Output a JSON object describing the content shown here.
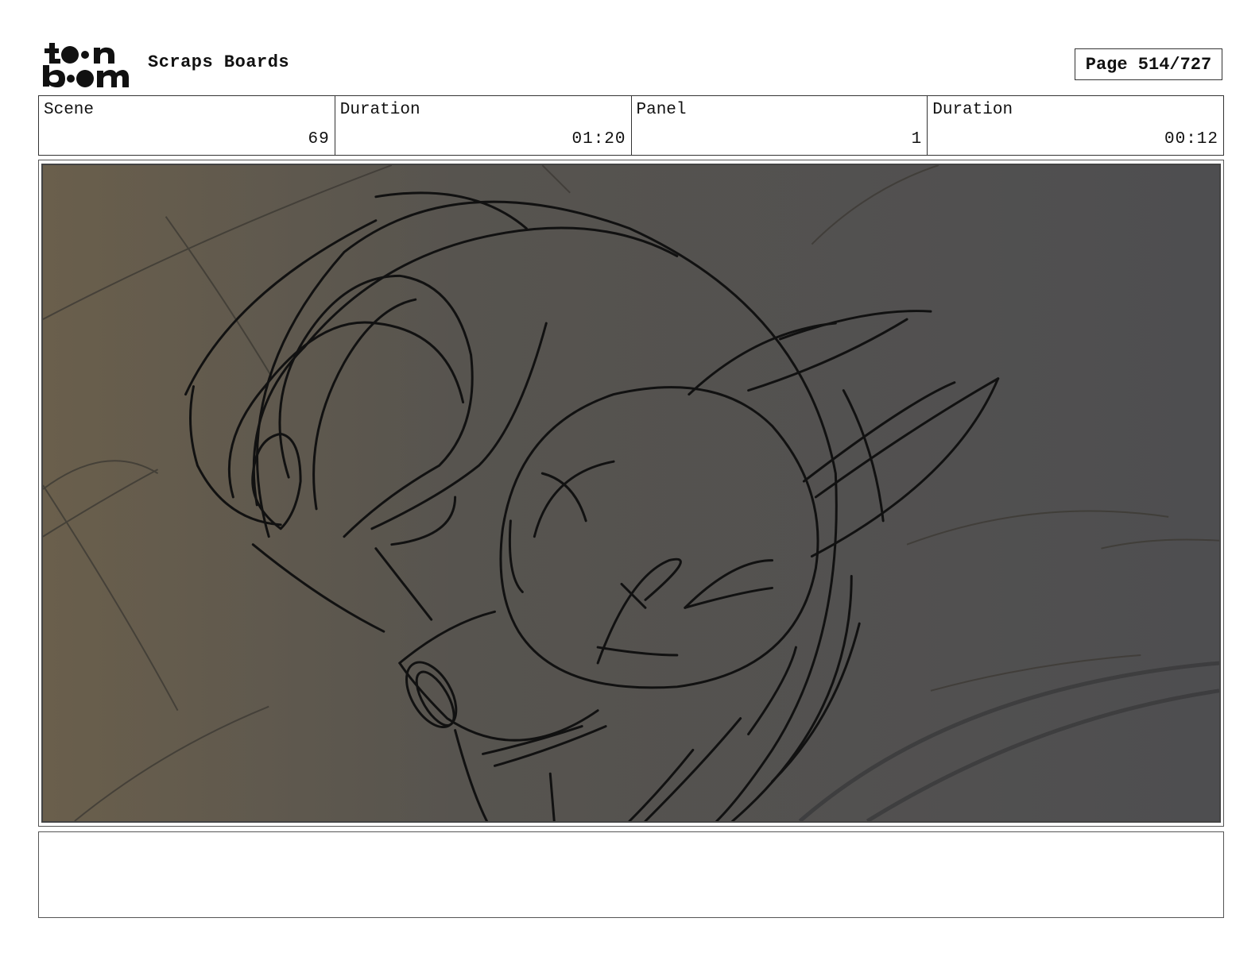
{
  "header": {
    "logo_alt": "toon boom",
    "title": "Scraps Boards",
    "page": "Page 514/727"
  },
  "info": [
    {
      "label": "Scene",
      "value": "69"
    },
    {
      "label": "Duration",
      "value": "01:20"
    },
    {
      "label": "Panel",
      "value": "1"
    },
    {
      "label": "Duration",
      "value": "00:12"
    }
  ],
  "panel": {
    "image_icon": "storyboard-sketch",
    "background_gradient": [
      "#6a5f4c",
      "#57544f",
      "#4e4e50"
    ],
    "stroke_color": "#111111"
  },
  "notes": {
    "text": ""
  }
}
